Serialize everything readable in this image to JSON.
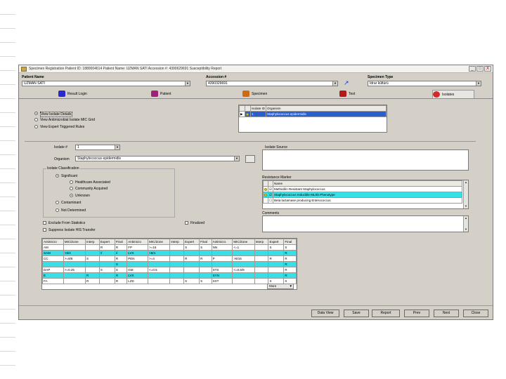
{
  "window": {
    "title": "Specimen Registration  Patient ID: 1880004614  Patient Name: UZMAN SATI  Accession #: 4390629691  Susceptibility Report",
    "buttons": [
      "_",
      "□",
      "X"
    ]
  },
  "header": {
    "patient_name_label": "Patient Name",
    "patient_name_value": "UZMAN SATI",
    "accession_label": "Accession #",
    "accession_value": "4390329691",
    "specimen_type_label": "Specimen Type",
    "specimen_type_value": "Idrar kültürü"
  },
  "tabs": [
    {
      "label": "Result Login",
      "icon": "runner-icon",
      "color": "#2a2ad0"
    },
    {
      "label": "Patient",
      "icon": "patient-icon",
      "color": "#a0207a"
    },
    {
      "label": "Specimen",
      "icon": "specimen-icon",
      "color": "#d06a10"
    },
    {
      "label": "Test",
      "icon": "test-icon",
      "color": "#b41a1a"
    },
    {
      "label": "Isolates",
      "icon": "isolates-icon",
      "color": "#d02a2a"
    }
  ],
  "view_options": [
    {
      "label": "View Isolate Details",
      "selected": true
    },
    {
      "label": "View Antimicrobial Isolate MIC Grid",
      "selected": false
    },
    {
      "label": "View Expert Triggered Rules",
      "selected": false
    }
  ],
  "isolate_list": {
    "headers": [
      "Isolate ID",
      "Organism"
    ],
    "rows": [
      {
        "id": "1",
        "organism": "Staphylococcus epidermidis"
      }
    ]
  },
  "isolate_form": {
    "isolate_label": "Isolate #",
    "isolate_value": "1",
    "organism_label": "Organism",
    "organism_value": "Staphylococcus epidermidis",
    "isolate_source_label": "Isolate Source"
  },
  "classification": {
    "title": "Isolate Classification",
    "options": [
      {
        "label": "Significant",
        "selected": true
      },
      {
        "label": "Healthcare Associated",
        "selected": false
      },
      {
        "label": "Community Acquired",
        "selected": false
      },
      {
        "label": "Unknown",
        "selected": true
      },
      {
        "label": "Contaminant",
        "selected": false
      },
      {
        "label": "Not Determined",
        "selected": false
      }
    ]
  },
  "checkboxes": [
    {
      "label": "Exclude From Statistics",
      "checked": false
    },
    {
      "label": "Suppress Isolate HIS Transfer",
      "checked": false
    },
    {
      "label": "Finalized",
      "checked": false
    }
  ],
  "resistance": {
    "title": "Resistance Marker",
    "header": "Name",
    "items": [
      {
        "label": "Methicillin Resistant Staphylococcus",
        "checked": true
      },
      {
        "label": "Staphylococcus Inducible MLSb Phenotype",
        "checked": true
      },
      {
        "label": "Beta lactamase producing Enterococcus",
        "checked": false
      }
    ],
    "comments_label": "Comments"
  },
  "mic_grid": {
    "headers": [
      "Antimicro",
      "MIC/Zone",
      "Interp",
      "Expert",
      "Final",
      "Antimicro",
      "MIC/Zone",
      "Interp",
      "Expert",
      "Final",
      "Antimicro",
      "MIC/Zone",
      "Interp",
      "Expert",
      "Final"
    ],
    "rows": [
      {
        "cells": [
          "AM",
          "",
          "",
          "R",
          "R",
          "FP",
          ">=16",
          "",
          "S",
          "S",
          "NN",
          "<=1",
          "",
          "S",
          "S"
        ],
        "cyan": false
      },
      {
        "cells": [
          "SAM",
          ">8/4",
          "",
          "//",
          "//",
          "LVX",
          ">8/4",
          "",
          "",
          "",
          "",
          "",
          "",
          "",
          "R"
        ],
        "cyan": true
      },
      {
        "cells": [
          "CC",
          ">=8/8",
          "S",
          "",
          "R",
          "PEN",
          ">=4",
          "",
          "R",
          "R",
          "P",
          ">8/16",
          "",
          "R",
          "R"
        ],
        "cyan": false
      },
      {
        "cells": [
          "",
          "",
          "",
          "",
          "S",
          "",
          "",
          "",
          "",
          "",
          "",
          "",
          "",
          "",
          "R"
        ],
        "cyan": true
      },
      {
        "cells": [
          "DAP",
          ">=0.25",
          "",
          "S",
          "S",
          "GM",
          "<=0.5",
          "",
          "",
          "",
          "STS",
          "<=0.5/9",
          "",
          "",
          "R"
        ],
        "cyan": false
      },
      {
        "cells": [
          "E",
          "",
          "R",
          "",
          "R",
          "LVX",
          "",
          "",
          "",
          "",
          "SYN",
          "",
          "",
          "",
          "R"
        ],
        "cyan": true
      },
      {
        "cells": [
          "FA",
          "",
          "R",
          "",
          "R",
          "LZD",
          "",
          "",
          "S",
          "S",
          "SXT",
          "",
          "",
          "S",
          "S"
        ],
        "cyan": false
      }
    ],
    "more_label": "More"
  },
  "footer_buttons": [
    "Data View",
    "Save",
    "Report",
    "Prev",
    "Next",
    "Close"
  ]
}
